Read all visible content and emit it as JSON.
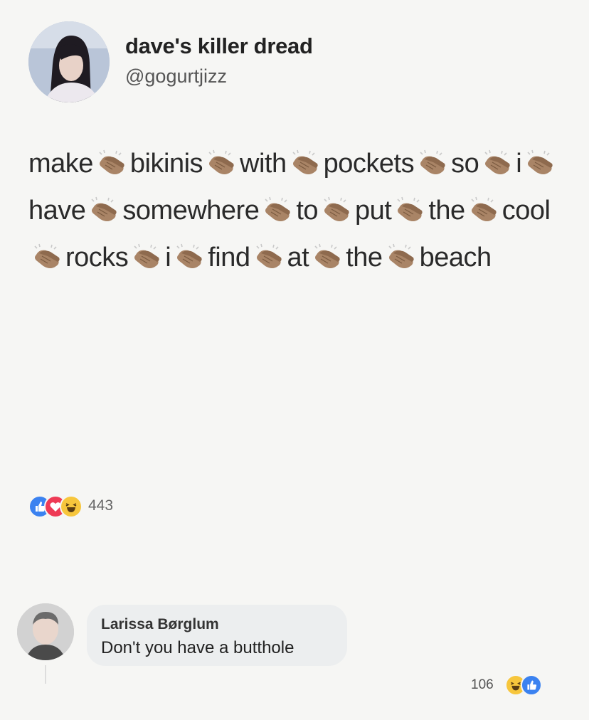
{
  "tweet": {
    "display_name": "dave's killer dread",
    "handle": "@gogurtjizz",
    "avatar_icon": "user-avatar",
    "words": [
      "make",
      "bikinis",
      "with",
      "pockets",
      "so",
      "i",
      "have",
      "somewhere",
      "to",
      "put",
      "the",
      "cool",
      "rocks",
      "i",
      "find",
      "at",
      "the",
      "beach"
    ],
    "separator_icon": "clapping-hands-icon"
  },
  "reactions": {
    "icons": [
      "like-icon",
      "love-icon",
      "haha-icon"
    ],
    "count": "443"
  },
  "comment": {
    "author": "Larissa Børglum",
    "text": "Don't you have a butthole",
    "avatar_icon": "user-avatar",
    "reaction_count": "106",
    "reaction_icons": [
      "haha-icon",
      "like-icon"
    ]
  },
  "colors": {
    "like": "#3b82f0",
    "love": "#ee3a55",
    "haha": "#f7c63c",
    "clap": "#a98466"
  }
}
